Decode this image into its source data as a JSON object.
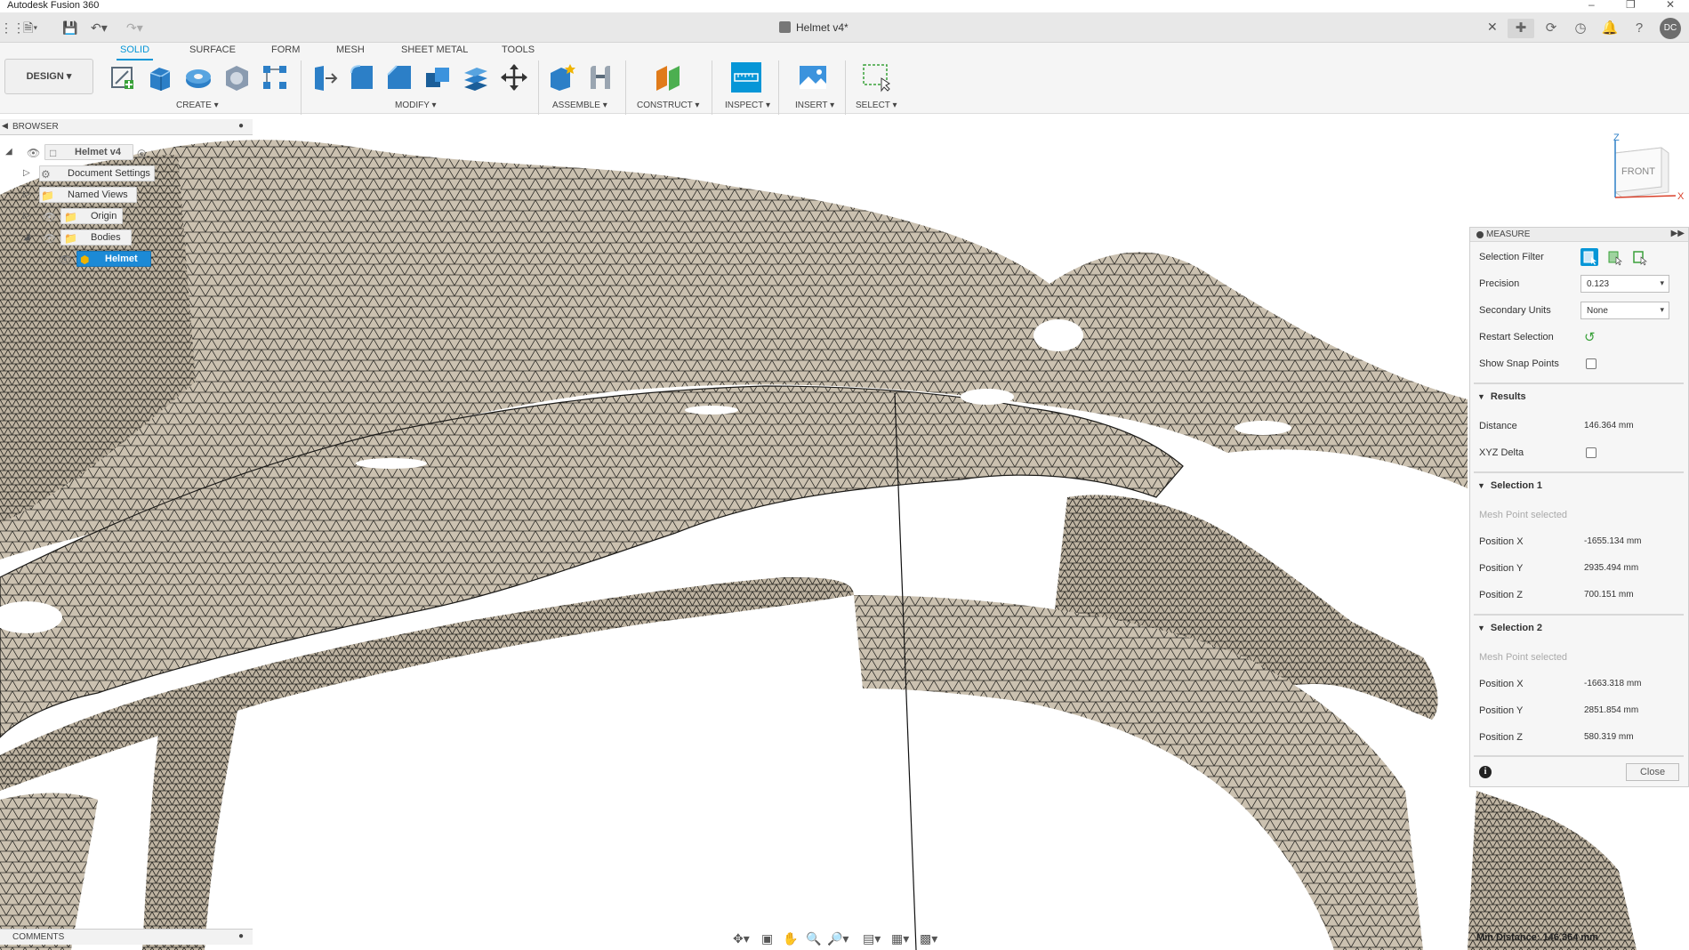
{
  "app": {
    "title": "Autodesk Fusion 360",
    "document_title": "Helmet v4*"
  },
  "toolbar": {
    "workspace": "DESIGN",
    "tabs": [
      "SOLID",
      "SURFACE",
      "FORM",
      "MESH",
      "SHEET METAL",
      "TOOLS"
    ],
    "active_tab": "SOLID",
    "groups": [
      "CREATE",
      "MODIFY",
      "ASSEMBLE",
      "CONSTRUCT",
      "INSPECT",
      "INSERT",
      "SELECT"
    ]
  },
  "header_right": {
    "avatar_initials": "DC"
  },
  "browser": {
    "title": "BROWSER",
    "items": [
      {
        "label": "Helmet v4",
        "level": 0
      },
      {
        "label": "Document Settings",
        "level": 1
      },
      {
        "label": "Named Views",
        "level": 1
      },
      {
        "label": "Origin",
        "level": 1
      },
      {
        "label": "Bodies",
        "level": 1
      },
      {
        "label": "Helmet",
        "level": 2
      }
    ]
  },
  "measure": {
    "title": "MEASURE",
    "selection_filter_label": "Selection Filter",
    "precision_label": "Precision",
    "precision_value": "0.123",
    "secondary_units_label": "Secondary Units",
    "secondary_units_value": "None",
    "restart_selection_label": "Restart Selection",
    "show_snap_points_label": "Show Snap Points",
    "results_title": "Results",
    "distance_label": "Distance",
    "distance_value": "146.364 mm",
    "xyz_delta_label": "XYZ Delta",
    "selection1": {
      "title": "Selection 1",
      "status": "Mesh Point selected",
      "position_x_label": "Position X",
      "position_x": "-1655.134 mm",
      "position_y_label": "Position Y",
      "position_y": "2935.494 mm",
      "position_z_label": "Position Z",
      "position_z": "700.151 mm"
    },
    "selection2": {
      "title": "Selection 2",
      "status": "Mesh Point selected",
      "position_x_label": "Position X",
      "position_x": "-1663.318 mm",
      "position_y_label": "Position Y",
      "position_y": "2851.854 mm",
      "position_z_label": "Position Z",
      "position_z": "580.319 mm"
    },
    "close_label": "Close"
  },
  "viewcube": {
    "face": "FRONT",
    "axis_z": "Z",
    "axis_x": "X"
  },
  "comments": {
    "title": "COMMENTS"
  },
  "status": {
    "text": "Min Distance: 146.364 mm"
  },
  "colors": {
    "accent": "#0696d7",
    "mesh_fill": "#c7bcaa",
    "mesh_line": "#2b2a26",
    "selection": "#1c8ad6"
  }
}
